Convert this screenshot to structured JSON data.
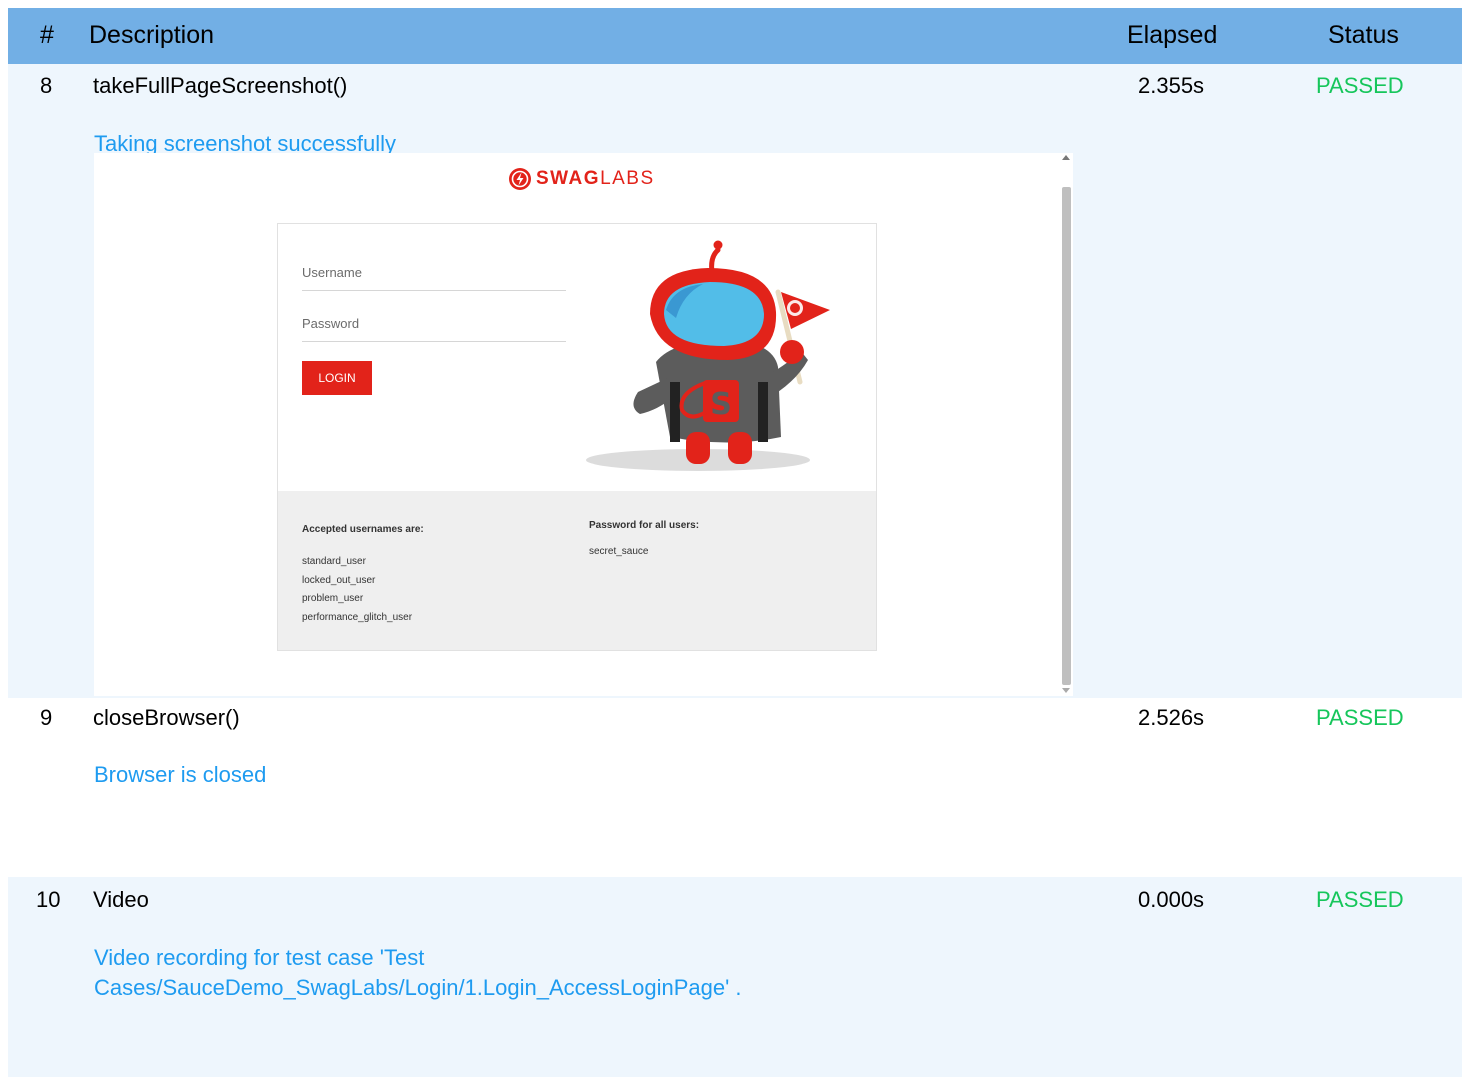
{
  "header": {
    "num": "#",
    "description": "Description",
    "elapsed": "Elapsed",
    "status": "Status"
  },
  "colors": {
    "header_bg": "#72afe5",
    "row_tint": "#eef6fd",
    "message": "#1e9bf0",
    "passed": "#16c65b",
    "brand_red": "#e2231a"
  },
  "rows": [
    {
      "num": "8",
      "description": "takeFullPageScreenshot()",
      "elapsed": "2.355s",
      "status": "PASSED",
      "message": "Taking screenshot successfully"
    },
    {
      "num": "9",
      "description": "closeBrowser()",
      "elapsed": "2.526s",
      "status": "PASSED",
      "message": "Browser is closed"
    },
    {
      "num": "10",
      "description": "Video",
      "elapsed": "0.000s",
      "status": "PASSED",
      "message_line1": "Video recording for test case 'Test",
      "message_line2": "Cases/SauceDemo_SwagLabs/Login/1.Login_AccessLoginPage' ."
    }
  ],
  "screenshot": {
    "logo_bold": "SWAG",
    "logo_light": "LABS",
    "username_placeholder": "Username",
    "password_placeholder": "Password",
    "login_button": "LOGIN",
    "usernames_heading": "Accepted usernames are:",
    "usernames": [
      "standard_user",
      "locked_out_user",
      "problem_user",
      "performance_glitch_user"
    ],
    "password_heading": "Password for all users:",
    "password": "secret_sauce"
  }
}
